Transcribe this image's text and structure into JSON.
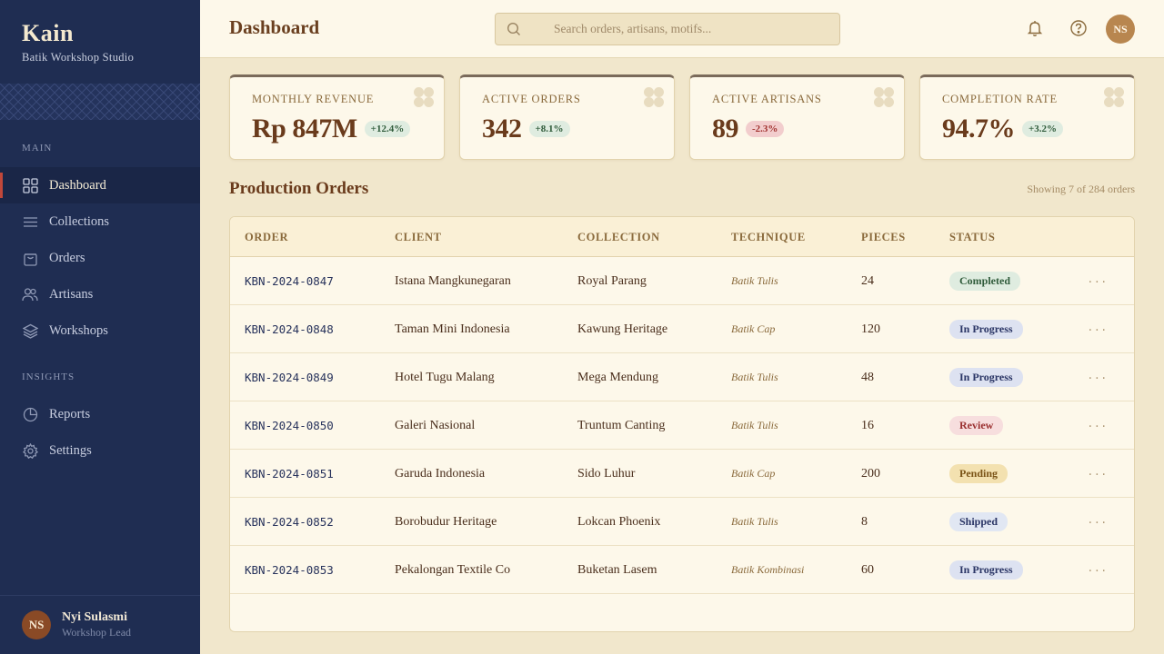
{
  "sidebar": {
    "brand_name": "Kain",
    "brand_subtitle": "Batik Workshop Studio",
    "sections": [
      "MAIN",
      "INSIGHTS"
    ],
    "main_items": [
      {
        "label": "Dashboard",
        "icon": "grid-icon",
        "active": true
      },
      {
        "label": "Collections",
        "icon": "menu-lines-icon"
      },
      {
        "label": "Orders",
        "icon": "shopping-bag-icon"
      },
      {
        "label": "Artisans",
        "icon": "users-icon"
      },
      {
        "label": "Workshops",
        "icon": "layers-icon"
      }
    ],
    "insight_items": [
      {
        "label": "Reports",
        "icon": "pie-chart-icon"
      },
      {
        "label": "Settings",
        "icon": "gear-icon"
      }
    ],
    "user": {
      "initials": "NS",
      "name": "Nyi Sulasmi",
      "role": "Workshop Lead"
    }
  },
  "header": {
    "title": "Dashboard",
    "search_placeholder": "Search orders, artisans, motifs...",
    "avatar_initials": "NS"
  },
  "stats": [
    {
      "label": "MONTHLY REVENUE",
      "value": "Rp 847M",
      "delta": "+12.4%",
      "trend": "up"
    },
    {
      "label": "ACTIVE ORDERS",
      "value": "342",
      "delta": "+8.1%",
      "trend": "up"
    },
    {
      "label": "ACTIVE ARTISANS",
      "value": "89",
      "delta": "-2.3%",
      "trend": "down"
    },
    {
      "label": "COMPLETION RATE",
      "value": "94.7%",
      "delta": "+3.2%",
      "trend": "up"
    }
  ],
  "orders": {
    "title": "Production Orders",
    "count_text": "Showing 7 of 284 orders",
    "columns": [
      "ORDER",
      "CLIENT",
      "COLLECTION",
      "TECHNIQUE",
      "PIECES",
      "STATUS"
    ],
    "rows": [
      {
        "order": "KBN-2024-0847",
        "client": "Istana Mangkunegaran",
        "collection": "Royal Parang",
        "technique": "Batik Tulis",
        "pieces": "24",
        "status": "Completed"
      },
      {
        "order": "KBN-2024-0848",
        "client": "Taman Mini Indonesia",
        "collection": "Kawung Heritage",
        "technique": "Batik Cap",
        "pieces": "120",
        "status": "In Progress"
      },
      {
        "order": "KBN-2024-0849",
        "client": "Hotel Tugu Malang",
        "collection": "Mega Mendung",
        "technique": "Batik Tulis",
        "pieces": "48",
        "status": "In Progress"
      },
      {
        "order": "KBN-2024-0850",
        "client": "Galeri Nasional",
        "collection": "Truntum Canting",
        "technique": "Batik Tulis",
        "pieces": "16",
        "status": "Review"
      },
      {
        "order": "KBN-2024-0851",
        "client": "Garuda Indonesia",
        "collection": "Sido Luhur",
        "technique": "Batik Cap",
        "pieces": "200",
        "status": "Pending"
      },
      {
        "order": "KBN-2024-0852",
        "client": "Borobudur Heritage",
        "collection": "Lokcan Phoenix",
        "technique": "Batik Tulis",
        "pieces": "8",
        "status": "Shipped"
      },
      {
        "order": "KBN-2024-0853",
        "client": "Pekalongan Textile Co",
        "collection": "Buketan Lasem",
        "technique": "Batik Kombinasi",
        "pieces": "60",
        "status": "In Progress"
      }
    ],
    "row_action": "..."
  },
  "colors": {
    "sidebar": "#1f2d52",
    "accent": "#c0473a",
    "brown": "#6a3b1c",
    "cream": "#fdf8ea"
  }
}
